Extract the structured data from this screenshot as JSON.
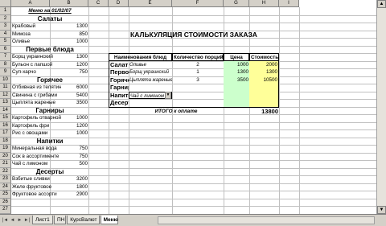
{
  "columns": [
    "A",
    "B",
    "C",
    "D",
    "E",
    "F",
    "G",
    "H",
    "I"
  ],
  "rows": [
    "1",
    "2",
    "3",
    "4",
    "5",
    "6",
    "7",
    "8",
    "9",
    "10",
    "11",
    "12",
    "13",
    "14",
    "15",
    "16",
    "17",
    "18",
    "19",
    "20",
    "21",
    "22",
    "23",
    "24",
    "25",
    "26",
    "27"
  ],
  "menu": {
    "title": "Меню на 01/02/07",
    "sections": [
      {
        "name": "Салаты",
        "items": [
          {
            "n": "Крабовый",
            "p": "1300"
          },
          {
            "n": "Мимоза",
            "p": "850"
          },
          {
            "n": "Оливье",
            "p": "1000"
          }
        ]
      },
      {
        "name": "Первые блюда",
        "items": [
          {
            "n": "Борщ украинский",
            "p": "1300"
          },
          {
            "n": "Бульон с лапшой",
            "p": "1200"
          },
          {
            "n": "Суп-харчо",
            "p": "750"
          }
        ]
      },
      {
        "name": "Горячее",
        "items": [
          {
            "n": "Отбивная из телятины",
            "p": "6000"
          },
          {
            "n": "Свинина с грибами",
            "p": "5400"
          },
          {
            "n": "Цыплята жареные",
            "p": "3500"
          }
        ]
      },
      {
        "name": "Гарниры",
        "items": [
          {
            "n": "Картофель отварной",
            "p": "1000"
          },
          {
            "n": "Картофель фри",
            "p": "1200"
          },
          {
            "n": "Рис с овощами",
            "p": "1000"
          }
        ]
      },
      {
        "name": "Напитки",
        "items": [
          {
            "n": "Минеральная вода",
            "p": "750"
          },
          {
            "n": "Сок в ассортименте",
            "p": "750"
          },
          {
            "n": "Чай с лимоном",
            "p": "500"
          }
        ]
      },
      {
        "name": "Десерты",
        "items": [
          {
            "n": "Взбитые сливки",
            "p": "3200"
          },
          {
            "n": "Желе фруктовое",
            "p": "1800"
          },
          {
            "n": "Фруктовое ассорти",
            "p": "2900"
          }
        ]
      }
    ]
  },
  "order": {
    "title": "КАЛЬКУЛЯЦИЯ СТОИМОСТИ ЗАКАЗА",
    "headers": {
      "dish": "Наименования блюд",
      "qty": "Количество порций",
      "price": "Цена",
      "cost": "Стоимость"
    },
    "rows": [
      {
        "cat": "Салат",
        "dish": "Оливье",
        "qty": "2",
        "price": "1000",
        "cost": "2000"
      },
      {
        "cat": "Первое",
        "dish": "Борщ украинский",
        "qty": "1",
        "price": "1300",
        "cost": "1300"
      },
      {
        "cat": "Горячее",
        "dish": "Цыплята жареные",
        "qty": "3",
        "price": "3500",
        "cost": "10500"
      },
      {
        "cat": "Гарнир",
        "dish": "",
        "qty": "",
        "price": "",
        "cost": ""
      },
      {
        "cat": "Напитки",
        "dish": "Чай с лимоном",
        "qty": "",
        "price": "",
        "cost": ""
      },
      {
        "cat": "Десерт",
        "dish": "",
        "qty": "",
        "price": "",
        "cost": ""
      }
    ],
    "total_label": "ИТОГО к оплате",
    "total_value": "13800"
  },
  "tabs": [
    "Лист1",
    "ПН",
    "КурсВалют",
    "Меню"
  ],
  "active_tab": "Меню",
  "colors": {
    "green": "#ccffcc",
    "yellow": "#ffff99",
    "header": "#d4d0c8"
  }
}
